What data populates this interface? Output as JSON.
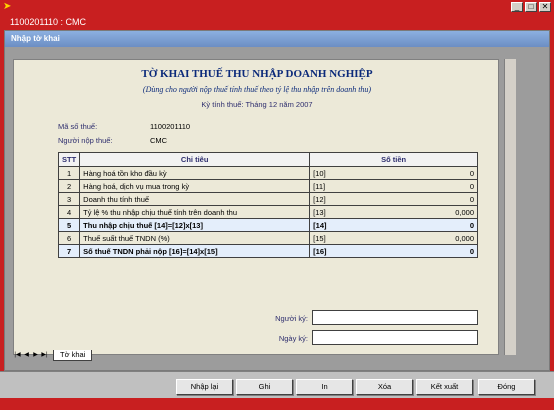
{
  "window": {
    "title": "1100201110 : CMC"
  },
  "doc": {
    "title": "Nhập tờ khai"
  },
  "form": {
    "title": "TỜ KHAI THUẾ THU NHẬP DOANH NGHIỆP",
    "subtitle": "(Dùng cho người nộp thuế tính thuế theo tỷ lệ thu nhập trên doanh thu)",
    "period": "Kỳ tính thuế: Tháng 12 năm 2007",
    "tax_code_label": "Mã số thuế:",
    "tax_code_value": "1100201110",
    "payer_label": "Người nộp thuế:",
    "payer_value": "CMC"
  },
  "table": {
    "headers": [
      "STT",
      "Chỉ tiêu",
      "Số tiền"
    ],
    "rows": [
      {
        "stt": "1",
        "label": "Hàng hoá tồn kho đầu kỳ",
        "code": "[10]",
        "value": "0"
      },
      {
        "stt": "2",
        "label": "Hàng hoá, dịch vụ mua trong kỳ",
        "code": "[11]",
        "value": "0"
      },
      {
        "stt": "3",
        "label": "Doanh thu tính thuế",
        "code": "[12]",
        "value": "0"
      },
      {
        "stt": "4",
        "label": "Tỷ lệ % thu nhập chịu thuế tính trên doanh thu",
        "code": "[13]",
        "value": "0,000"
      },
      {
        "stt": "5",
        "label": "Thu nhập chịu thuế [14]=[12]x[13]",
        "code": "[14]",
        "value": "0"
      },
      {
        "stt": "6",
        "label": "Thuế suất thuế TNDN (%)",
        "code": "[15]",
        "value": "0,000"
      },
      {
        "stt": "7",
        "label": "Số thuế TNDN phải nộp [16]=[14]x[15]",
        "code": "[16]",
        "value": "0"
      }
    ]
  },
  "signature": {
    "signer_label": "Người ký:",
    "date_label": "Ngày ký:"
  },
  "tabs": {
    "active": "Tờ khai"
  },
  "buttons": {
    "reset": "Nhập lại",
    "save": "Ghi",
    "print": "In",
    "delete": "Xóa",
    "export": "Kết xuất",
    "close": "Đóng"
  }
}
